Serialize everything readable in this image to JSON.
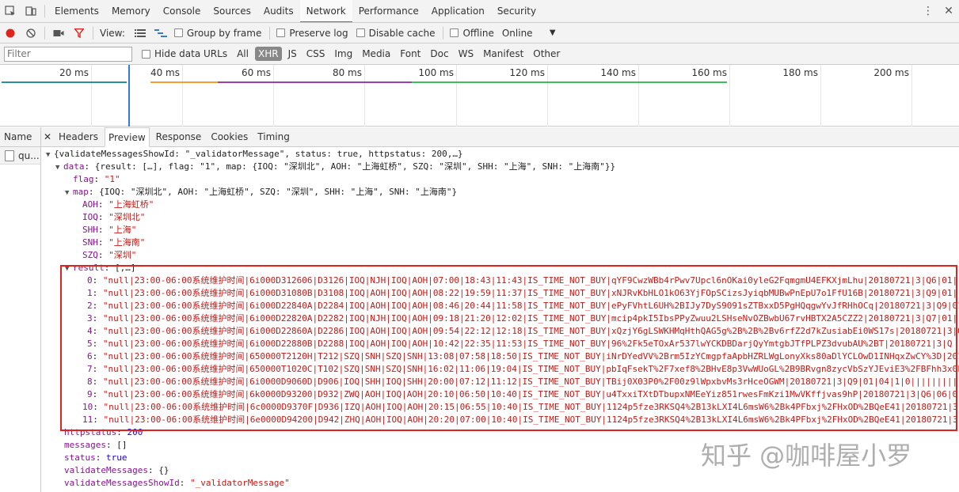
{
  "tabs": {
    "items": [
      "Elements",
      "Memory",
      "Console",
      "Sources",
      "Audits",
      "Network",
      "Performance",
      "Application",
      "Security"
    ],
    "selected": "Network"
  },
  "toolbar": {
    "view_label": "View:",
    "group_by_frame": "Group by frame",
    "preserve_log": "Preserve log",
    "disable_cache": "Disable cache",
    "offline": "Offline",
    "throttle": "Online"
  },
  "filterbar": {
    "placeholder": "Filter",
    "hide_data_urls": "Hide data URLs",
    "types": [
      "All",
      "XHR",
      "JS",
      "CSS",
      "Img",
      "Media",
      "Font",
      "Doc",
      "WS",
      "Manifest",
      "Other"
    ],
    "active_type": "XHR"
  },
  "overview": {
    "ticks": [
      "20 ms",
      "40 ms",
      "60 ms",
      "80 ms",
      "100 ms",
      "120 ms",
      "140 ms",
      "160 ms",
      "180 ms",
      "200 ms"
    ],
    "colors": {
      "teal": "#2b8fa3",
      "orange": "#f0a030",
      "purple": "#9c3fb4",
      "green": "#3fbf5c",
      "blue": "#3879d9"
    }
  },
  "requests": {
    "header": "Name",
    "rows": [
      "qu..."
    ]
  },
  "detail": {
    "tabs": [
      "Headers",
      "Preview",
      "Response",
      "Cookies",
      "Timing"
    ],
    "selected": "Preview"
  },
  "preview": {
    "root": "{validateMessagesShowId: \"_validatorMessage\", status: true, httpstatus: 200,…}",
    "data_summary": "{result: […], flag: \"1\", map: {IOQ: \"深圳北\", AOH: \"上海虹桥\", SZQ: \"深圳\", SHH: \"上海\", SNH: \"上海南\"}}",
    "flag_key": "flag",
    "flag_val": "\"1\"",
    "map_summary": "{IOQ: \"深圳北\", AOH: \"上海虹桥\", SZQ: \"深圳\", SHH: \"上海\", SNH: \"上海南\"}",
    "map_entries": [
      {
        "k": "AOH",
        "v": "\"上海虹桥\""
      },
      {
        "k": "IOQ",
        "v": "\"深圳北\""
      },
      {
        "k": "SHH",
        "v": "\"上海\""
      },
      {
        "k": "SNH",
        "v": "\"上海南\""
      },
      {
        "k": "SZQ",
        "v": "\"深圳\""
      }
    ],
    "result_summary": "[,…]",
    "result_items": [
      {
        "i": "0",
        "v": "\"null|23:00-06:00系统维护时间|6i000D312606|D3126|IOQ|NJH|IOQ|AOH|07:00|18:43|11:43|IS_TIME_NOT_BUY|qYF9CwzWBb4rPwv7Upcl6nOKai0yleG2FqmgmU4EFKXjmLhu|20180721|3|Q6|01|"
      },
      {
        "i": "1",
        "v": "\"null|23:00-06:00系统维护时间|6i000D31080B|D3108|IOQ|AOH|IOQ|AOH|08:22|19:59|11:37|IS_TIME_NOT_BUY|xNJRvKbHLO1kO63YjFOpSCizsJyiqbMUBwPnEpU7o1FfU16B|20180721|3|Q9|01|"
      },
      {
        "i": "2",
        "v": "\"null|23:00-06:00系统维护时间|6i000D22840A|D2284|IOQ|AOH|IOQ|AOH|08:46|20:44|11:58|IS_TIME_NOT_BUY|ePyFVhtL6UH%2BIJy7DyS9091sZTBxxD5PgHQqgwYvJfRHhOCq|20180721|3|Q9|01|"
      },
      {
        "i": "3",
        "v": "\"null|23:00-06:00系统维护时间|6i000D22820A|D2282|IOQ|NJH|IOQ|AOH|09:18|21:20|12:02|IS_TIME_NOT_BUY|mcip4pkI5IbsPPyZwuu2LSHseNvOZBwbU67rvHBTX2A5CZZ2|20180721|3|Q7|01|"
      },
      {
        "i": "4",
        "v": "\"null|23:00-06:00系统维护时间|6i000D22860A|D2286|IOQ|AOH|IOQ|AOH|09:54|22:12|12:18|IS_TIME_NOT_BUY|xQzjY6gLSWKHMqHthQAG5g%2B%2B%2Bv6rfZ2d7kZusiabEi0WS17s|20180721|3|Q"
      },
      {
        "i": "5",
        "v": "\"null|23:00-06:00系统维护时间|6i000D22880B|D2288|IOQ|AOH|IOQ|AOH|10:42|22:35|11:53|IS_TIME_NOT_BUY|96%2Fk5eTOxAr537lwYCKDBDarjQyYmtgbJTfPLPZ3dvubAU%2BT|20180721|3|Q"
      },
      {
        "i": "6",
        "v": "\"null|23:00-06:00系统维护时间|650000T2120H|T212|SZQ|SNH|SZQ|SNH|13:08|07:58|18:50|IS_TIME_NOT_BUY|iNrDYedVV%2Brm5IzYCmgpfaApbHZRLWgLonyXks80aDlYCLOwD1INHqxZwCY%3D|201"
      },
      {
        "i": "7",
        "v": "\"null|23:00-06:00系统维护时间|650000T1020C|T102|SZQ|SNH|SZQ|SNH|16:02|11:06|19:04|IS_TIME_NOT_BUY|pbIqFsekT%2F7xef8%2BHvE8p3VwWUoGL%2B9BRvgn8zycVbSzYJEviE3%2FBFhh3x0k"
      },
      {
        "i": "8",
        "v": "\"null|23:00-06:00系统维护时间|6i0000D9060D|D906|IOQ|SHH|IOQ|SHH|20:00|07:12|11:12|IS_TIME_NOT_BUY|TBij0X03P0%2F00z9lWpxbvMs3rHceOGWM|20180721|3|Q9|01|04|1|0||||||||||"
      },
      {
        "i": "9",
        "v": "\"null|23:00-06:00系统维护时间|6k0000D93200|D932|ZWQ|AOH|IOQ|AOH|20:10|06:50|10:40|IS_TIME_NOT_BUY|u4TxxiTXtDTbupxNMEeYiz851rwesFmKzi1MwVKffjvas9hP|20180721|3|Q6|06|0"
      },
      {
        "i": "10",
        "v": "\"null|23:00-06:00系统维护时间|6c0000D9370F|D936|IZQ|AOH|IOQ|AOH|20:15|06:55|10:40|IS_TIME_NOT_BUY|1124p5fze3RKSQ4%2B13kLXI4L6msW6%2Bk4PFbxj%2FHxOD%2BQeE41|20180721|3"
      },
      {
        "i": "11",
        "v": "\"null|23:00-06:00系统维护时间|6e0000D94200|D942|ZHQ|AOH|IOQ|AOH|20:20|07:00|10:40|IS_TIME_NOT_BUY|1124p5fze3RKSQ4%2B13kLXI4L6msW6%2Bk4PFbxj%2FHxOD%2BQeE41|20180721|3"
      }
    ],
    "httpstatus_val": "200",
    "messages_val": "[]",
    "status_val": "true",
    "validateMessages_val": "{}",
    "showId_val": "\"_validatorMessage\""
  },
  "watermark": "知乎 @咖啡屋小罗"
}
